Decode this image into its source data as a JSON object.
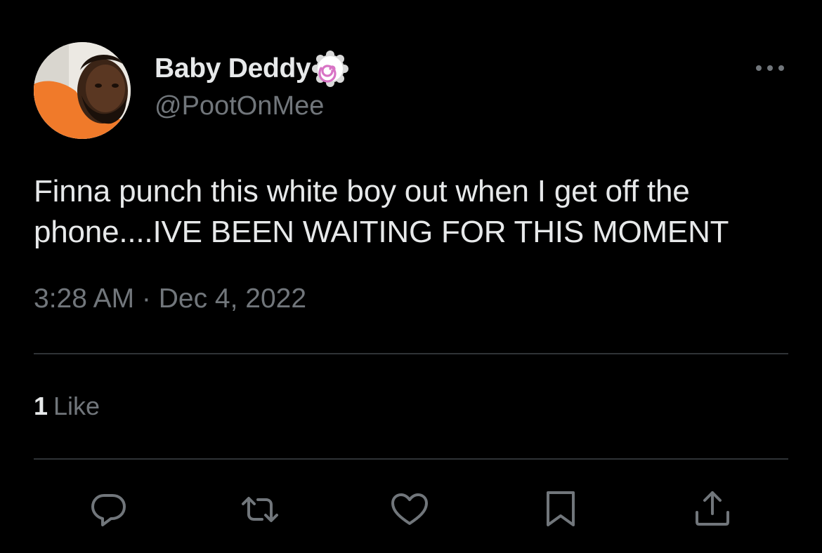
{
  "tweet": {
    "author": {
      "display_name": "Baby Deddy",
      "handle": "@PootOnMee",
      "badge_icon": "pink-swirl-emoji-icon"
    },
    "text_line1": "Finna punch this white boy out when I get off the",
    "text_line2": "phone....IVE BEEN WAITING FOR THIS MOMENT",
    "timestamp": "3:28 AM · Dec 4, 2022",
    "stats": {
      "likes_count": "1",
      "likes_label": "Like"
    },
    "actions": [
      "reply-icon",
      "retweet-icon",
      "like-icon",
      "bookmark-icon",
      "share-icon"
    ]
  },
  "colors": {
    "background": "#000000",
    "primary_text": "#e7e9ea",
    "secondary_text": "#71767b",
    "divider": "#2f3336",
    "badge_pink": "#d873c5"
  }
}
